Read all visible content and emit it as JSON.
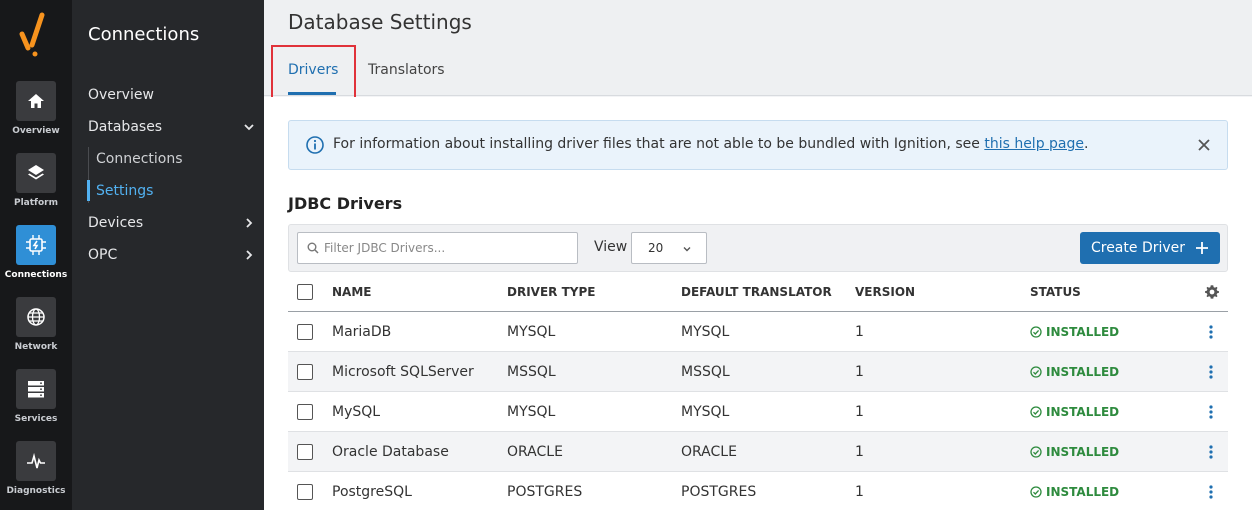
{
  "rail": {
    "items": [
      {
        "label": "Overview",
        "icon": "home-icon"
      },
      {
        "label": "Platform",
        "icon": "layers-icon"
      },
      {
        "label": "Connections",
        "icon": "connections-icon"
      },
      {
        "label": "Network",
        "icon": "globe-icon"
      },
      {
        "label": "Services",
        "icon": "server-icon"
      },
      {
        "label": "Diagnostics",
        "icon": "pulse-icon"
      }
    ],
    "active": "Connections",
    "accent": "#2f8fd6",
    "logo_color": "#f7931e"
  },
  "nav": {
    "title": "Connections",
    "items": {
      "overview": "Overview",
      "databases": "Databases",
      "connections": "Connections",
      "settings": "Settings",
      "devices": "Devices",
      "opc": "OPC"
    }
  },
  "header": {
    "title": "Database Settings",
    "tabs": {
      "drivers": "Drivers",
      "translators": "Translators"
    },
    "active_tab": "Drivers"
  },
  "info": {
    "text": "For information about installing driver files that are not able to be bundled with Ignition, see ",
    "link": "this help page",
    "suffix": "."
  },
  "section": {
    "title": "JDBC Drivers"
  },
  "toolbar": {
    "search_placeholder": "Filter JDBC Drivers...",
    "view_label": "View",
    "view_value": "20",
    "create_label": "Create Driver"
  },
  "table": {
    "headers": {
      "name": "NAME",
      "driver_type": "DRIVER TYPE",
      "translator": "DEFAULT TRANSLATOR",
      "version": "VERSION",
      "status": "STATUS"
    },
    "rows": [
      {
        "name": "MariaDB",
        "driver_type": "MYSQL",
        "translator": "MYSQL",
        "version": "1",
        "status": "INSTALLED"
      },
      {
        "name": "Microsoft SQLServer",
        "driver_type": "MSSQL",
        "translator": "MSSQL",
        "version": "1",
        "status": "INSTALLED"
      },
      {
        "name": "MySQL",
        "driver_type": "MYSQL",
        "translator": "MYSQL",
        "version": "1",
        "status": "INSTALLED"
      },
      {
        "name": "Oracle Database",
        "driver_type": "ORACLE",
        "translator": "ORACLE",
        "version": "1",
        "status": "INSTALLED"
      },
      {
        "name": "PostgreSQL",
        "driver_type": "POSTGRES",
        "translator": "POSTGRES",
        "version": "1",
        "status": "INSTALLED"
      }
    ],
    "status_color": "#2e8b3e"
  }
}
